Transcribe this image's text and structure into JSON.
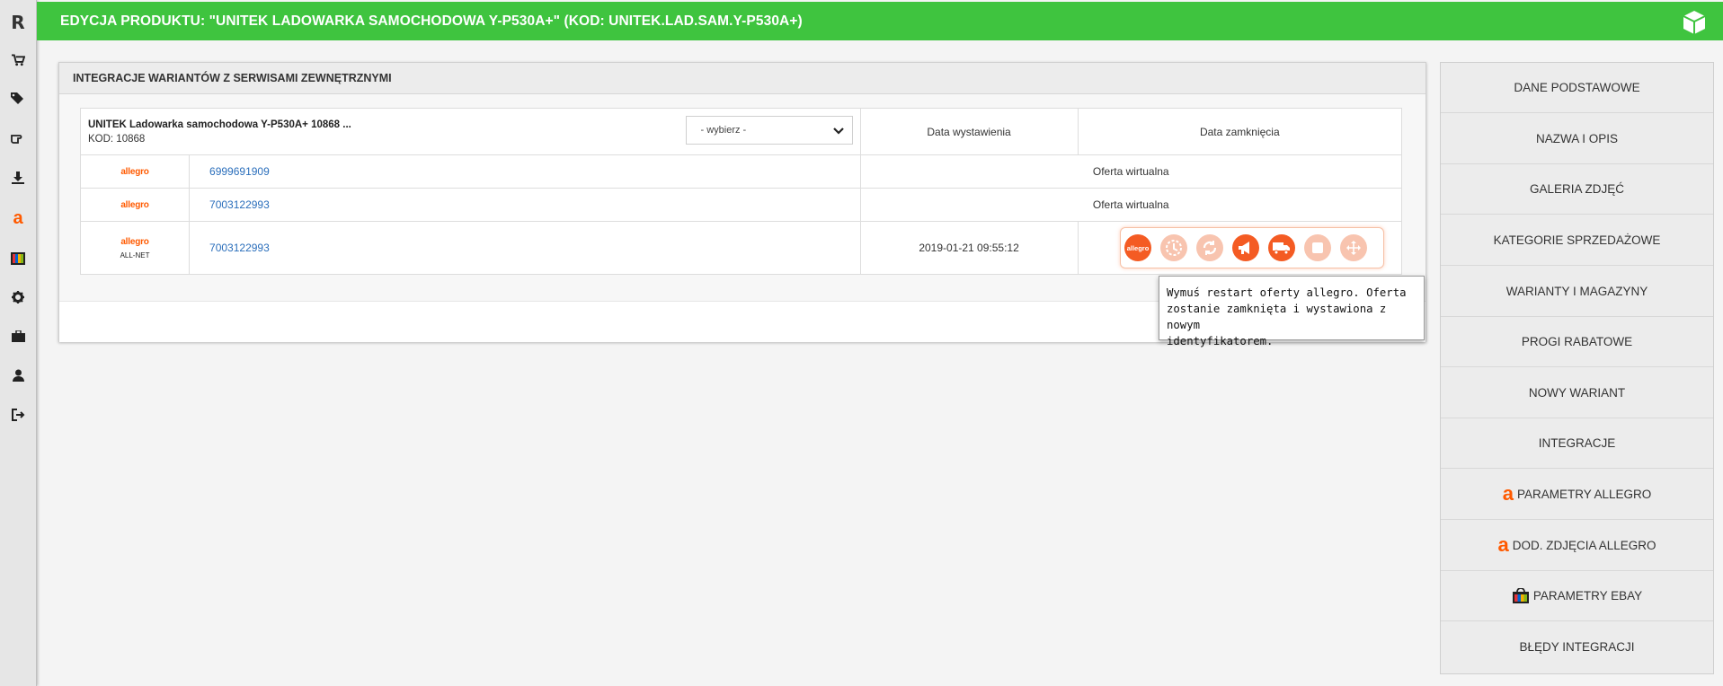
{
  "header": {
    "title": "EDYCJA PRODUKTU: \"UNITEK LADOWARKA SAMOCHODOWA Y-P530A+\" (KOD: UNITEK.LAD.SAM.Y-P530A+)",
    "accent_color": "#3fc43f",
    "right_icon": "cube-icon"
  },
  "sidebar": {
    "items": [
      {
        "name": "logo-icon",
        "glyph": "R"
      },
      {
        "name": "cart-icon"
      },
      {
        "name": "tags-icon"
      },
      {
        "name": "hand-point-icon"
      },
      {
        "name": "download-icon"
      },
      {
        "name": "allegro-icon",
        "glyph": "a"
      },
      {
        "name": "ebay-icon"
      },
      {
        "name": "gear-icon"
      },
      {
        "name": "briefcase-icon"
      },
      {
        "name": "user-icon"
      },
      {
        "name": "logout-icon"
      }
    ]
  },
  "panel": {
    "title": "INTEGRACJE WARIANTÓW Z SERWISAMI ZEWNĘTRZNYMI",
    "product": {
      "name": "UNITEK Ladowarka samochodowa Y-P530A+ 10868 ...",
      "code": "KOD: 10868"
    },
    "select": {
      "value": "- wybierz -"
    },
    "columns": {
      "date_listed": "Data wystawienia",
      "date_closed": "Data zamknięcia"
    },
    "rows": [
      {
        "service": "allegro",
        "sublabel": "",
        "id": "6999691909",
        "status": "Oferta wirtualna"
      },
      {
        "service": "allegro",
        "sublabel": "",
        "id": "7003122993",
        "status": "Oferta wirtualna"
      },
      {
        "service": "allegro",
        "sublabel": "ALL-NET",
        "id": "7003122993",
        "date_listed": "2019-01-21 09:55:12"
      }
    ],
    "actions": [
      {
        "name": "allegro-action-icon",
        "label": "allegro",
        "active": true
      },
      {
        "name": "restart-offer-icon",
        "active": false
      },
      {
        "name": "refresh-icon",
        "active": false
      },
      {
        "name": "megaphone-icon",
        "active": true
      },
      {
        "name": "truck-icon",
        "active": true
      },
      {
        "name": "stop-icon",
        "active": false
      },
      {
        "name": "move-icon",
        "active": false
      }
    ],
    "tooltip": {
      "line1": "Wymuś restart oferty allegro. Oferta",
      "line2": "zostanie zamknięta i wystawiona z nowym",
      "line3": "identyfikatorem."
    }
  },
  "rightnav": {
    "items": [
      {
        "label": "DANE PODSTAWOWE"
      },
      {
        "label": "NAZWA I OPIS"
      },
      {
        "label": "GALERIA ZDJĘĆ"
      },
      {
        "label": "KATEGORIE SPRZEDAŻOWE"
      },
      {
        "label": "WARIANTY I MAGAZYNY"
      },
      {
        "label": "PROGI RABATOWE"
      },
      {
        "label": "NOWY WARIANT"
      },
      {
        "label": "INTEGRACJE"
      },
      {
        "label": "PARAMETRY ALLEGRO",
        "icon": "allegro-icon"
      },
      {
        "label": "DOD. ZDJĘCIA ALLEGRO",
        "icon": "allegro-icon"
      },
      {
        "label": "PARAMETRY EBAY",
        "icon": "ebay-bag-icon"
      },
      {
        "label": "BŁĘDY INTEGRACJI"
      }
    ]
  },
  "colors": {
    "allegro": "#ff5a00",
    "link": "#2a6ebb"
  }
}
